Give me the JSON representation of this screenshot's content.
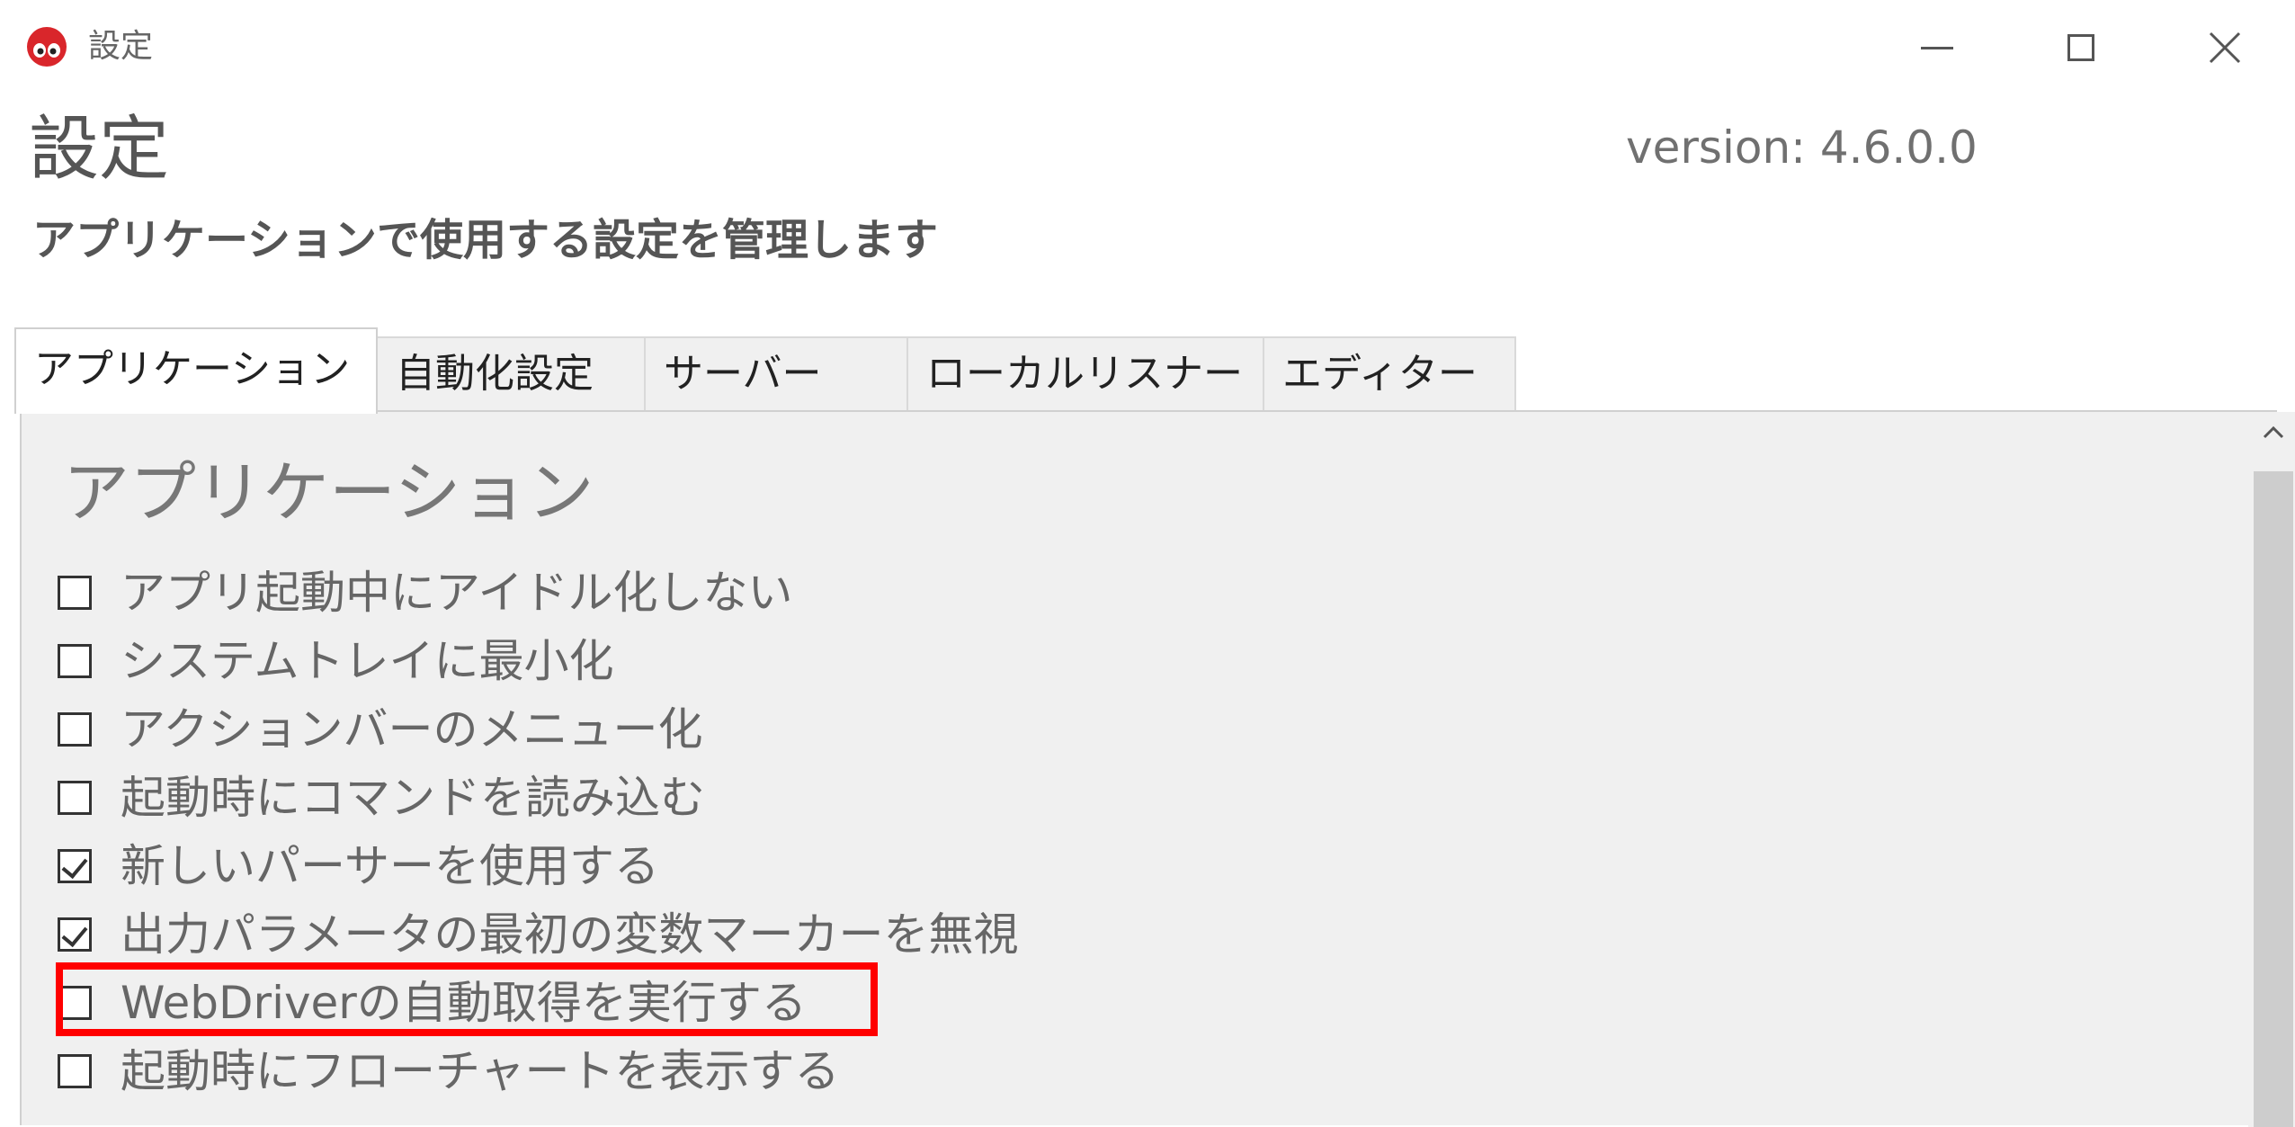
{
  "window": {
    "title": "設定",
    "icon": "red-robot-app-icon",
    "controls": {
      "minimize": "minimize-icon",
      "maximize": "maximize-icon",
      "close": "close-icon"
    }
  },
  "header": {
    "title": "設定",
    "version": "version: 4.6.0.0",
    "subtitle": "アプリケーションで使用する設定を管理します"
  },
  "tabs": [
    {
      "label": "アプリケーション",
      "active": true
    },
    {
      "label": "自動化設定",
      "active": false
    },
    {
      "label": "サーバー",
      "active": false
    },
    {
      "label": "ローカルリスナー",
      "active": false
    },
    {
      "label": "エディター",
      "active": false
    }
  ],
  "section": {
    "title": "アプリケーション",
    "options": [
      {
        "label": "アプリ起動中にアイドル化しない",
        "checked": false
      },
      {
        "label": "システムトレイに最小化",
        "checked": false
      },
      {
        "label": "アクションバーのメニュー化",
        "checked": false
      },
      {
        "label": "起動時にコマンドを読み込む",
        "checked": false
      },
      {
        "label": "新しいパーサーを使用する",
        "checked": true
      },
      {
        "label": "出力パラメータの最初の変数マーカーを無視",
        "checked": true
      },
      {
        "label": "WebDriverの自動取得を実行する",
        "checked": false,
        "highlighted": true
      },
      {
        "label": "起動時にフローチャートを表示する",
        "checked": false
      }
    ]
  },
  "colors": {
    "highlight": "#ff0000",
    "panel_bg": "#f0f0f0"
  }
}
